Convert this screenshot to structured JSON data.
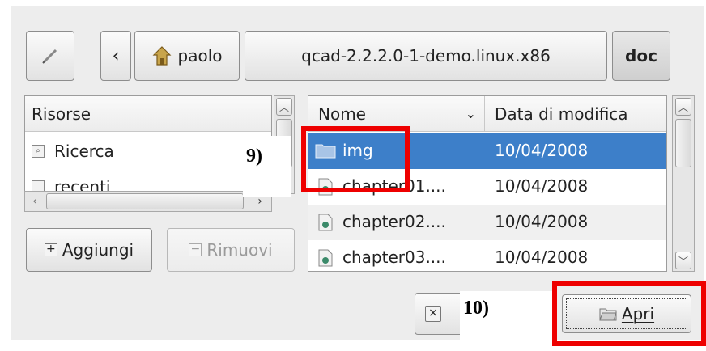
{
  "toolbar": {
    "back_glyph": "‹",
    "home_label": "paolo",
    "path_segment": "qcad-2.2.2.0-1-demo.linux.x86",
    "current_segment": "doc"
  },
  "places": {
    "header": "Risorse",
    "items": [
      "Ricerca",
      "recenti"
    ]
  },
  "files": {
    "columns": [
      "Nome",
      "Data di modifica"
    ],
    "rows": [
      {
        "name": "img",
        "date": "10/04/2008"
      },
      {
        "name": "chapter01....",
        "date": "10/04/2008"
      },
      {
        "name": "chapter02....",
        "date": "10/04/2008"
      },
      {
        "name": "chapter03....",
        "date": "10/04/2008"
      }
    ]
  },
  "buttons": {
    "add": "Aggiungi",
    "remove": "Rimuovi",
    "open": "Apri"
  },
  "annotations": {
    "label_9": "9)",
    "label_10": "10)"
  },
  "colors": {
    "selection": "#3d7fc9",
    "highlight": "#ee0000"
  },
  "icons": [
    "edit-icon",
    "home-icon",
    "folder-icon",
    "document-icon",
    "add-icon",
    "remove-icon",
    "cancel-icon",
    "open-folder-icon"
  ]
}
